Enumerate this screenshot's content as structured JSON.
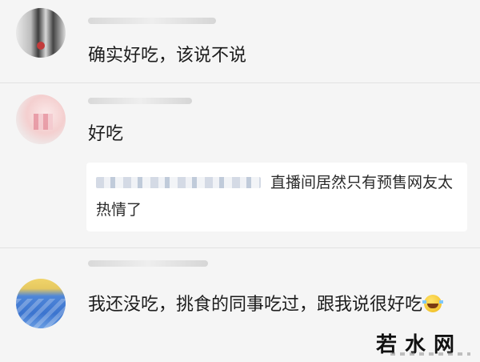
{
  "comments": [
    {
      "text": "确实好吃，该说不说"
    },
    {
      "text": "好吃",
      "quote": {
        "text": "直播间居然只有预售网友太热情了"
      }
    },
    {
      "text": "我还没吃，挑食的同事吃过，跟我说很好吃",
      "emoji": "laughing-tears-emoji-icon"
    }
  ],
  "watermark": "若水网"
}
